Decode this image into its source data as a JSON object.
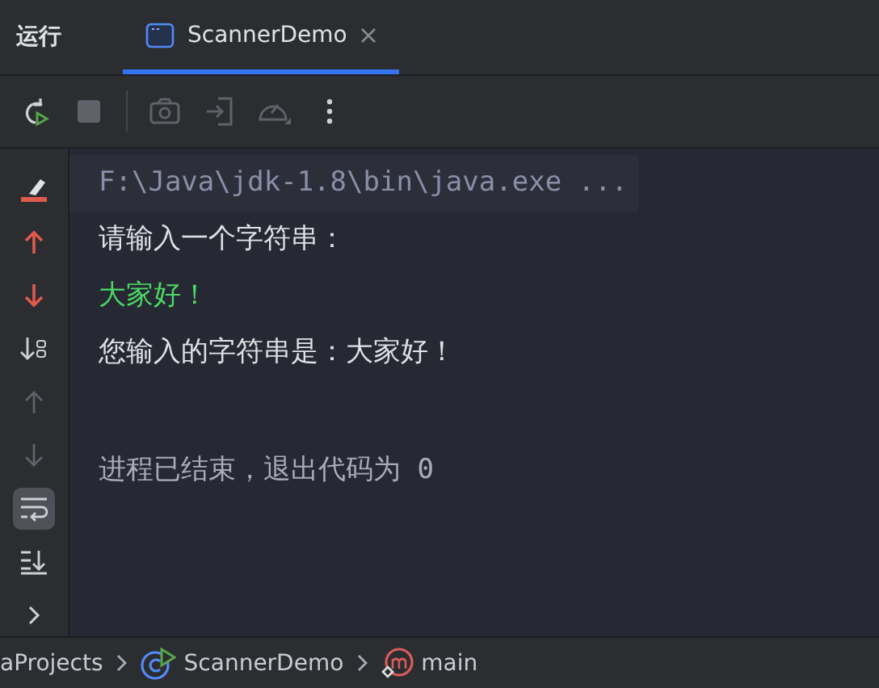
{
  "header": {
    "title": "运行",
    "tabs": [
      {
        "label": "ScannerDemo",
        "selected": true
      }
    ]
  },
  "toolbar": [
    {
      "kind": "rerun",
      "disabled": false
    },
    {
      "kind": "stop",
      "disabled": true
    },
    {
      "kind": "separator"
    },
    {
      "kind": "camera",
      "disabled": true
    },
    {
      "kind": "exit",
      "disabled": true
    },
    {
      "kind": "gauge",
      "disabled": true
    },
    {
      "kind": "more",
      "disabled": false
    }
  ],
  "gutter": [
    {
      "kind": "clear",
      "disabled": false,
      "selected": false
    },
    {
      "kind": "prev-error",
      "disabled": false,
      "selected": false
    },
    {
      "kind": "next-error",
      "disabled": false,
      "selected": false
    },
    {
      "kind": "sort",
      "disabled": false,
      "selected": false
    },
    {
      "kind": "up",
      "disabled": true,
      "selected": false
    },
    {
      "kind": "down",
      "disabled": true,
      "selected": false
    },
    {
      "kind": "wrap",
      "disabled": false,
      "selected": true
    },
    {
      "kind": "scroll-end",
      "disabled": false,
      "selected": false
    },
    {
      "kind": "chevron",
      "disabled": false,
      "selected": false
    }
  ],
  "console": [
    {
      "kind": "command",
      "text": "F:\\Java\\jdk-1.8\\bin\\java.exe ..."
    },
    {
      "kind": "output",
      "text": "请输入一个字符串："
    },
    {
      "kind": "input",
      "text": "大家好！"
    },
    {
      "kind": "output",
      "text": "您输入的字符串是：大家好！"
    },
    {
      "kind": "exit",
      "text": "进程已结束，退出代码为 0"
    }
  ],
  "breadcrumb": [
    {
      "kind": "project",
      "label": "aProjects"
    },
    {
      "kind": "class",
      "label": "ScannerDemo"
    },
    {
      "kind": "method",
      "label": "main"
    }
  ]
}
